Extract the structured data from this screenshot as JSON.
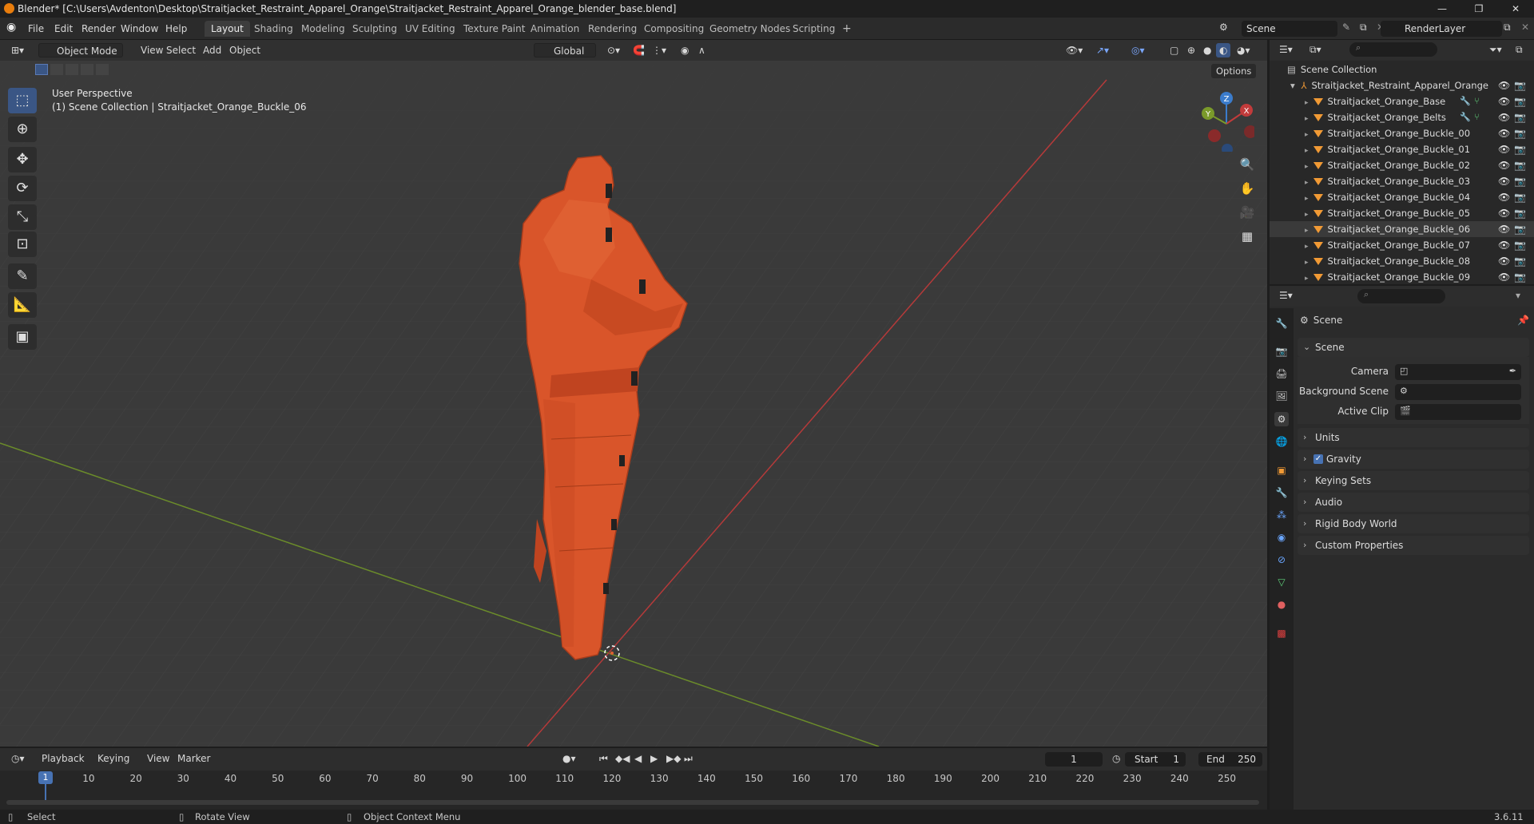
{
  "window": {
    "title": "Blender* [C:\\Users\\Avdenton\\Desktop\\Straitjacket_Restraint_Apparel_Orange\\Straitjacket_Restraint_Apparel_Orange_blender_base.blend]",
    "minimize": "—",
    "maximize": "❐",
    "close": "✕"
  },
  "menu": [
    "File",
    "Edit",
    "Render",
    "Window",
    "Help"
  ],
  "workspaces": [
    "Layout",
    "Shading",
    "Modeling",
    "Sculpting",
    "UV Editing",
    "Texture Paint",
    "Animation",
    "Rendering",
    "Compositing",
    "Geometry Nodes",
    "Scripting"
  ],
  "workspace_add": "+",
  "scene_selector": "Scene",
  "renderlayer_selector": "RenderLayer",
  "viewport": {
    "mode": "Object Mode",
    "header_menus": [
      "View",
      "Select",
      "Add",
      "Object"
    ],
    "orientation": "Global",
    "options_label": "Options",
    "overlay_line1": "User Perspective",
    "overlay_line2": "(1) Scene Collection | Straitjacket_Orange_Buckle_06",
    "gizmo": {
      "x": "X",
      "y": "Y",
      "z": "Z"
    }
  },
  "outliner": {
    "root": "Scene Collection",
    "collection": "Straitjacket_Restraint_Apparel_Orange",
    "items": [
      "Straitjacket_Orange_Base",
      "Straitjacket_Orange_Belts",
      "Straitjacket_Orange_Buckle_00",
      "Straitjacket_Orange_Buckle_01",
      "Straitjacket_Orange_Buckle_02",
      "Straitjacket_Orange_Buckle_03",
      "Straitjacket_Orange_Buckle_04",
      "Straitjacket_Orange_Buckle_05",
      "Straitjacket_Orange_Buckle_06",
      "Straitjacket_Orange_Buckle_07",
      "Straitjacket_Orange_Buckle_08",
      "Straitjacket_Orange_Buckle_09"
    ],
    "selected_index": 8
  },
  "properties": {
    "context": "Scene",
    "panel_open": "Scene",
    "fields": {
      "camera": "Camera",
      "background_scene": "Background Scene",
      "active_clip": "Active Clip"
    },
    "panels": [
      "Units",
      "Gravity",
      "Keying Sets",
      "Audio",
      "Rigid Body World",
      "Custom Properties"
    ],
    "gravity_checked": true
  },
  "timeline": {
    "menus": [
      "Playback",
      "Keying",
      "View",
      "Marker"
    ],
    "current_frame": "1",
    "start_label": "Start",
    "start": "1",
    "end_label": "End",
    "end": "250",
    "ticks": [
      "1",
      "10",
      "20",
      "30",
      "40",
      "50",
      "60",
      "70",
      "80",
      "90",
      "100",
      "110",
      "120",
      "130",
      "140",
      "150",
      "160",
      "170",
      "180",
      "190",
      "200",
      "210",
      "220",
      "230",
      "240",
      "250"
    ]
  },
  "statusbar": {
    "left": "Select",
    "middle": "Rotate View",
    "right": "Object Context Menu",
    "version": "3.6.11"
  },
  "colors": {
    "accent": "#3a5685",
    "orange": "#e0572a",
    "x_axis": "#c23b3b",
    "y_axis": "#7a9a2a"
  }
}
